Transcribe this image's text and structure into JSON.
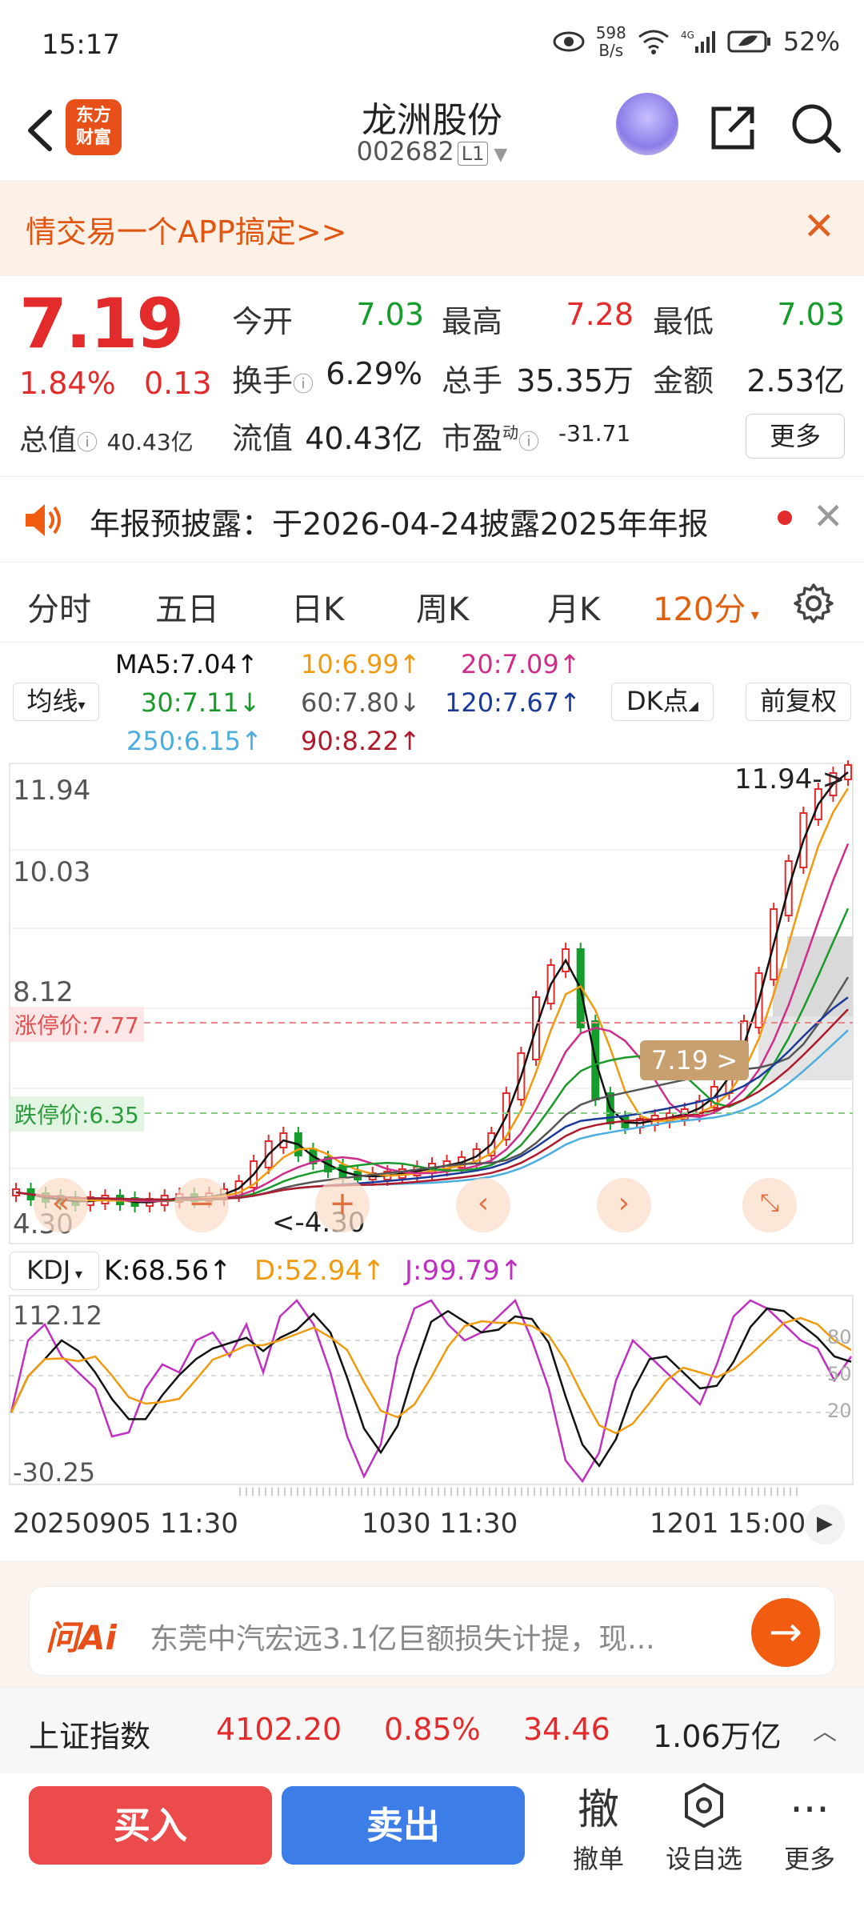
{
  "status": {
    "time": "15:17",
    "net_speed": "598",
    "net_unit": "B/s",
    "signal": "4G",
    "battery": "52%"
  },
  "header": {
    "title": "龙洲股份",
    "code": "002682",
    "level": "L1"
  },
  "banner": {
    "text": "情交易一个APP搞定>>",
    "close": "✕"
  },
  "quote": {
    "price": "7.19",
    "pct": "1.84%",
    "change": "0.13",
    "open_label": "今开",
    "open": "7.03",
    "high_label": "最高",
    "high": "7.28",
    "low_label": "最低",
    "low": "7.03",
    "turnover_label": "换手",
    "turnover": "6.29%",
    "volume_label": "总手",
    "volume": "35.35万",
    "amount_label": "金额",
    "amount": "2.53亿",
    "mktcap_label": "总值",
    "mktcap": "40.43亿",
    "float_label": "流值",
    "float": "40.43亿",
    "pe_label": "市盈",
    "pe_sup": "动",
    "pe": "-31.71",
    "more": "更多"
  },
  "notice": {
    "text": "年报预披露：于2026-04-24披露2025年年报"
  },
  "tabs": [
    "分时",
    "五日",
    "日K",
    "周K",
    "月K",
    "120分"
  ],
  "tab_active_index": 5,
  "ma": {
    "selector": "均线",
    "ma5": "MA5:7.04↑",
    "ma10": "10:6.99↑",
    "ma20": "20:7.09↑",
    "ma30": "30:7.11↓",
    "ma60": "60:7.80↓",
    "ma120": "120:7.67↑",
    "ma250": "250:6.15↑",
    "ma90": "90:8.22↑",
    "dk_button": "DK点",
    "adjust_button": "前复权"
  },
  "kline": {
    "y_labels": [
      "11.94",
      "10.03",
      "8.12",
      "4.30"
    ],
    "max_marker": "11.94->",
    "min_marker": "<-4.30",
    "limit_up": "涨停价:7.77",
    "limit_down": "跌停价:6.35",
    "price_tag": "7.19 >"
  },
  "kdj": {
    "selector": "KDJ",
    "k": "K:68.56↑",
    "d": "D:52.94↑",
    "j": "J:99.79↑",
    "top": "112.12",
    "bottom": "-30.25",
    "levels": [
      "80",
      "50",
      "20"
    ]
  },
  "dates": [
    "20250905 11:30",
    "1030 11:30",
    "1201 15:00"
  ],
  "ai": {
    "brand": "问Ai",
    "text": "东莞中汽宏远3.1亿巨额损失计提，现..."
  },
  "index": {
    "name": "上证指数",
    "value": "4102.20",
    "pct": "0.85%",
    "change": "34.46",
    "amount": "1.06万亿"
  },
  "actions": {
    "buy": "买入",
    "sell": "卖出",
    "cancel_icon": "撤",
    "cancel": "撤单",
    "watch": "设自选",
    "more": "更多"
  },
  "colors": {
    "up": "#e32b2b",
    "down": "#149d2a",
    "accent": "#e8501a",
    "ma5": "#111111",
    "ma10": "#f09a10",
    "ma20": "#d02c8c",
    "ma30": "#1a9a2a",
    "ma60": "#555555",
    "ma120": "#1a3a9a",
    "ma250": "#4aaee0",
    "ma90": "#b01a2a"
  }
}
